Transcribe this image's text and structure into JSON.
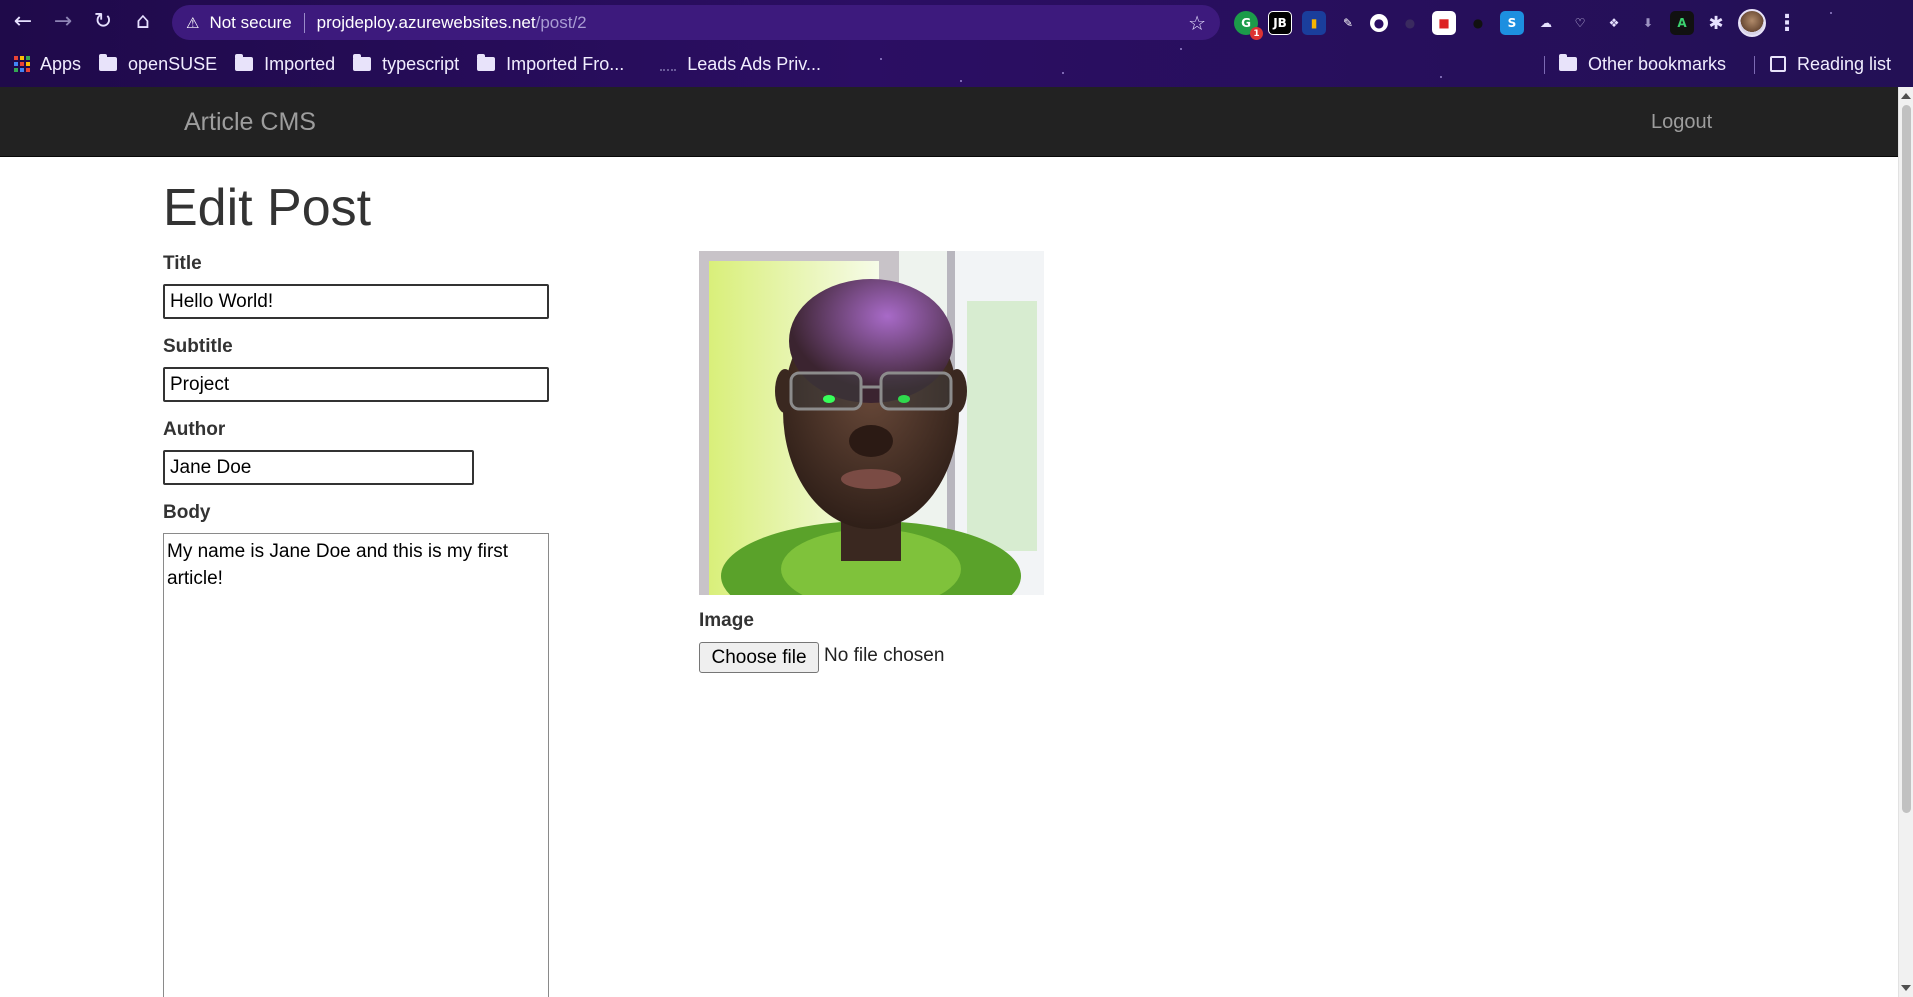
{
  "browser": {
    "address": {
      "security_label": "Not secure",
      "host": "projdeploy.azurewebsites.net",
      "path": "/post/2"
    },
    "bookmarks": [
      {
        "label": "Apps",
        "type": "apps"
      },
      {
        "label": "openSUSE",
        "type": "folder"
      },
      {
        "label": "Imported",
        "type": "folder"
      },
      {
        "label": "typescript",
        "type": "folder"
      },
      {
        "label": "Imported Fro...",
        "type": "folder"
      },
      {
        "label": "Leads Ads Priv...",
        "type": "page"
      }
    ],
    "other_bookmarks": "Other bookmarks",
    "reading_list": "Reading list",
    "extension_badge": "1",
    "theme_color": "#2b0e63"
  },
  "app": {
    "brand": "Article CMS",
    "logout": "Logout",
    "navbar_color": "#222222"
  },
  "form": {
    "heading": "Edit Post",
    "title_label": "Title",
    "title_value": "Hello World!",
    "subtitle_label": "Subtitle",
    "subtitle_value": "Project",
    "author_label": "Author",
    "author_value": "Jane Doe",
    "body_label": "Body",
    "body_value": "My name is Jane Doe and this is my first article!",
    "image_label": "Image",
    "choose_file": "Choose file",
    "file_status": "No file chosen"
  }
}
